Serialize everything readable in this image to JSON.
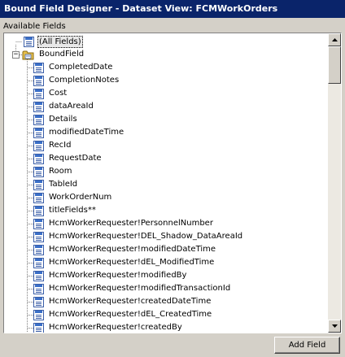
{
  "window": {
    "title": "Bound Field Designer - Dataset View: FCMWorkOrders"
  },
  "available_fields": {
    "label": "Available Fields",
    "all_fields": "(All Fields)",
    "group": "BoundField",
    "fields": [
      "CompletedDate",
      "CompletionNotes",
      "Cost",
      "dataAreaId",
      "Details",
      "modifiedDateTime",
      "RecId",
      "RequestDate",
      "Room",
      "TableId",
      "WorkOrderNum",
      "titleFields**",
      "HcmWorkerRequester!PersonnelNumber",
      "HcmWorkerRequester!DEL_Shadow_DataAreaId",
      "HcmWorkerRequester!modifiedDateTime",
      "HcmWorkerRequester!dEL_ModifiedTime",
      "HcmWorkerRequester!modifiedBy",
      "HcmWorkerRequester!modifiedTransactionId",
      "HcmWorkerRequester!createdDateTime",
      "HcmWorkerRequester!dEL_CreatedTime",
      "HcmWorkerRequester!createdBy"
    ]
  },
  "buttons": {
    "add_field": "Add Field"
  },
  "colors": {
    "titlebar": "#0a246a",
    "field_icon": "#3a5ea8",
    "folder": "#e8c04a"
  },
  "icons": {
    "field": "field-icon",
    "folder": "folder-icon",
    "expander": "collapse-expander-icon"
  }
}
